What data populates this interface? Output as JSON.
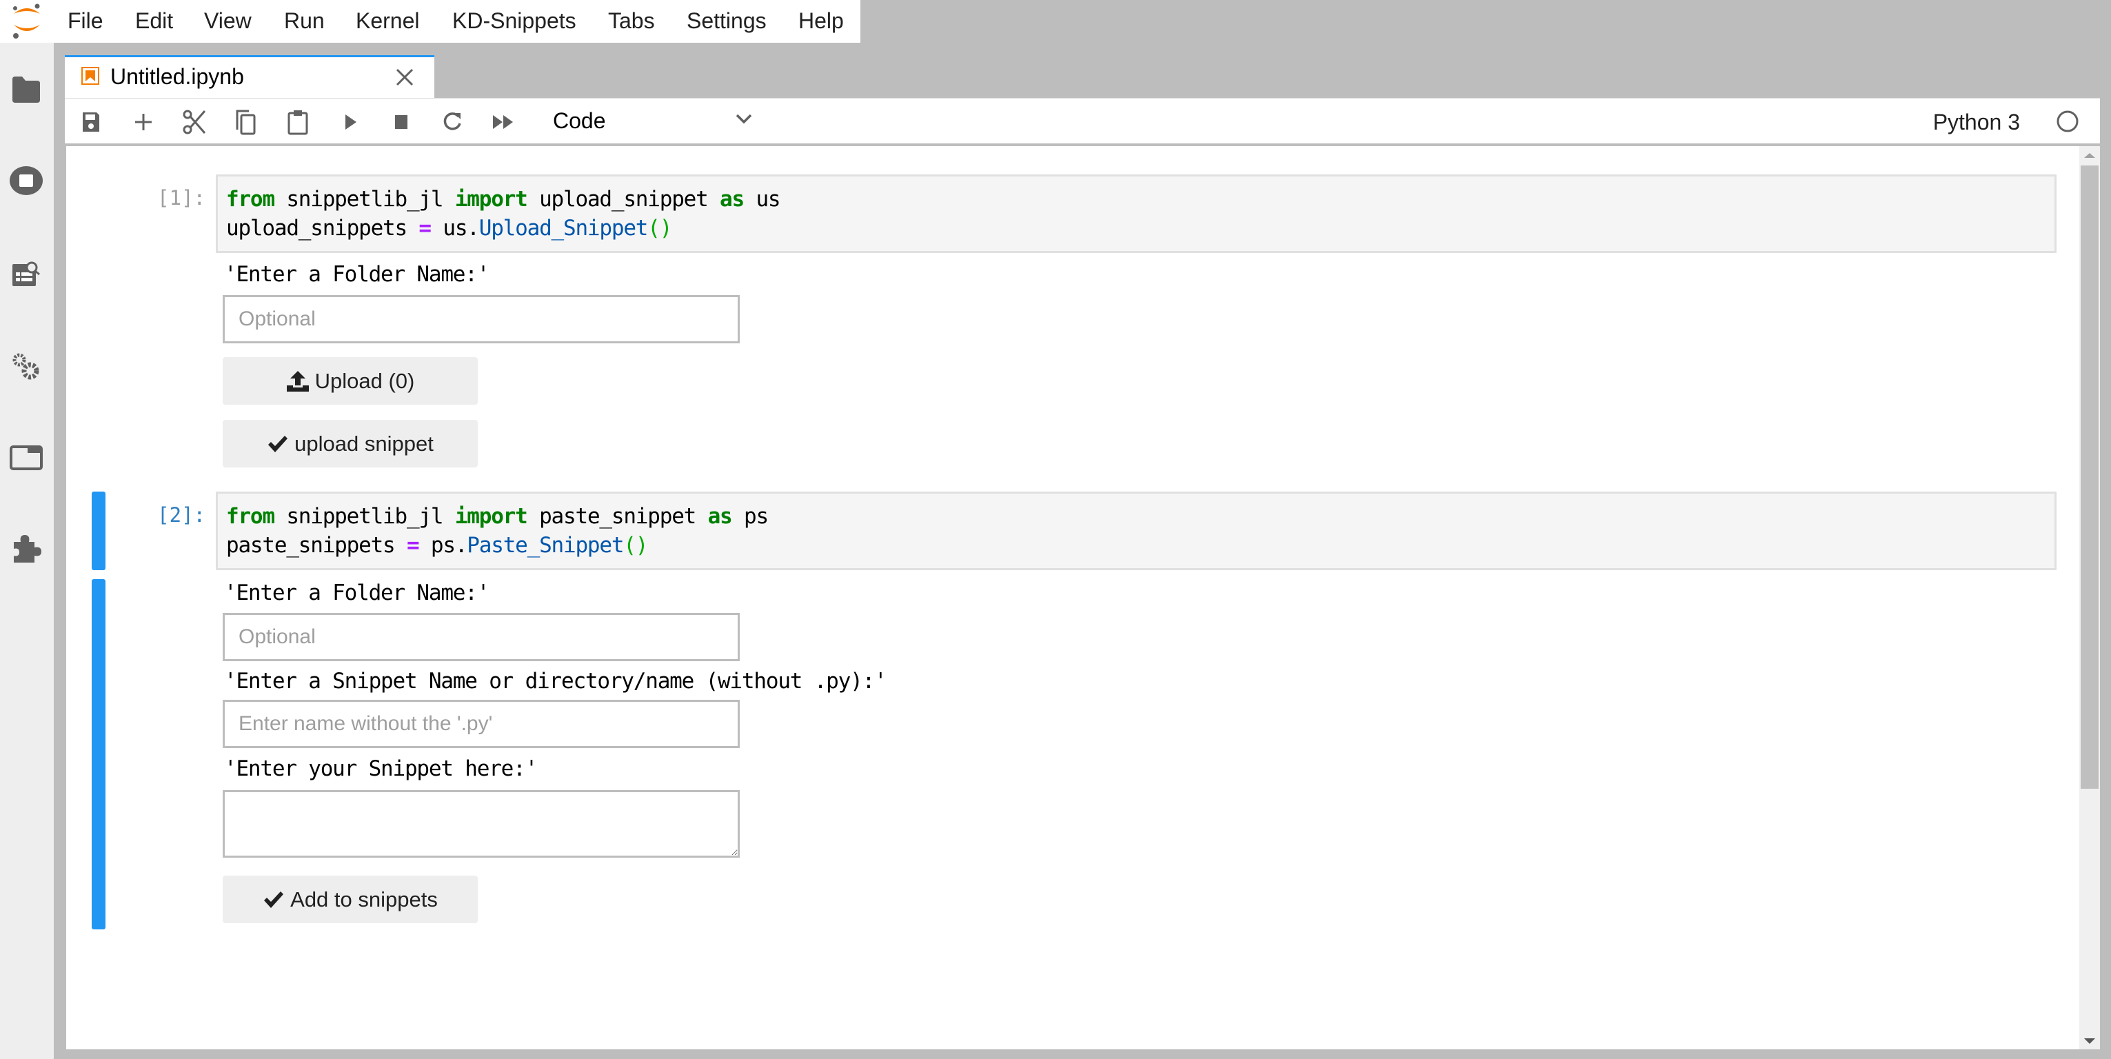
{
  "menubar": {
    "items": [
      "File",
      "Edit",
      "View",
      "Run",
      "Kernel",
      "KD-Snippets",
      "Tabs",
      "Settings",
      "Help"
    ]
  },
  "sidebar": {
    "icons": [
      "folder-icon",
      "running-stop-icon",
      "property-inspector-icon",
      "settings-gears-icon",
      "tabs-window-icon",
      "extension-puzzle-icon"
    ]
  },
  "tab": {
    "title": "Untitled.ipynb"
  },
  "toolbar": {
    "buttons": [
      "save",
      "insert-cell",
      "cut",
      "copy",
      "paste",
      "run",
      "interrupt",
      "restart",
      "restart-run-all"
    ],
    "cell_type": "Code",
    "kernel_name": "Python 3",
    "kernel_status": "idle"
  },
  "cells": [
    {
      "prompt": "[1]:",
      "code": {
        "line1": {
          "kw1": "from",
          "mod": " snippetlib_jl ",
          "kw2": "import",
          "name": " upload_snippet ",
          "kw3": "as",
          "alias": " us"
        },
        "line2": {
          "var": "upload_snippets ",
          "op": "=",
          "obj": " us.",
          "cls": "Upload_Snippet",
          "paren": "()"
        }
      },
      "output": {
        "folder_label": "'Enter a Folder Name:'",
        "folder_placeholder": "Optional",
        "folder_value": "",
        "upload_button": "Upload (0)",
        "upload_snippet_button": "upload snippet"
      }
    },
    {
      "prompt": "[2]:",
      "code": {
        "line1": {
          "kw1": "from",
          "mod": " snippetlib_jl ",
          "kw2": "import",
          "name": " paste_snippet ",
          "kw3": "as",
          "alias": " ps"
        },
        "line2": {
          "var": "paste_snippets ",
          "op": "=",
          "obj": " ps.",
          "cls": "Paste_Snippet",
          "paren": "()"
        }
      },
      "output": {
        "folder_label": "'Enter a Folder Name:'",
        "folder_placeholder": "Optional",
        "folder_value": "",
        "snippet_name_label": "'Enter a Snippet Name or directory/name (without .py):'",
        "snippet_name_placeholder": "Enter name without the '.py'",
        "snippet_name_value": "",
        "snippet_body_label": "'Enter your Snippet here:'",
        "snippet_body_value": "",
        "add_button": "Add to snippets"
      }
    }
  ],
  "colors": {
    "accent": "#2196f3",
    "brand_orange": "#f57c00",
    "keyword": "#008000",
    "operator": "#aa22ff",
    "class_name": "#0055aa"
  }
}
